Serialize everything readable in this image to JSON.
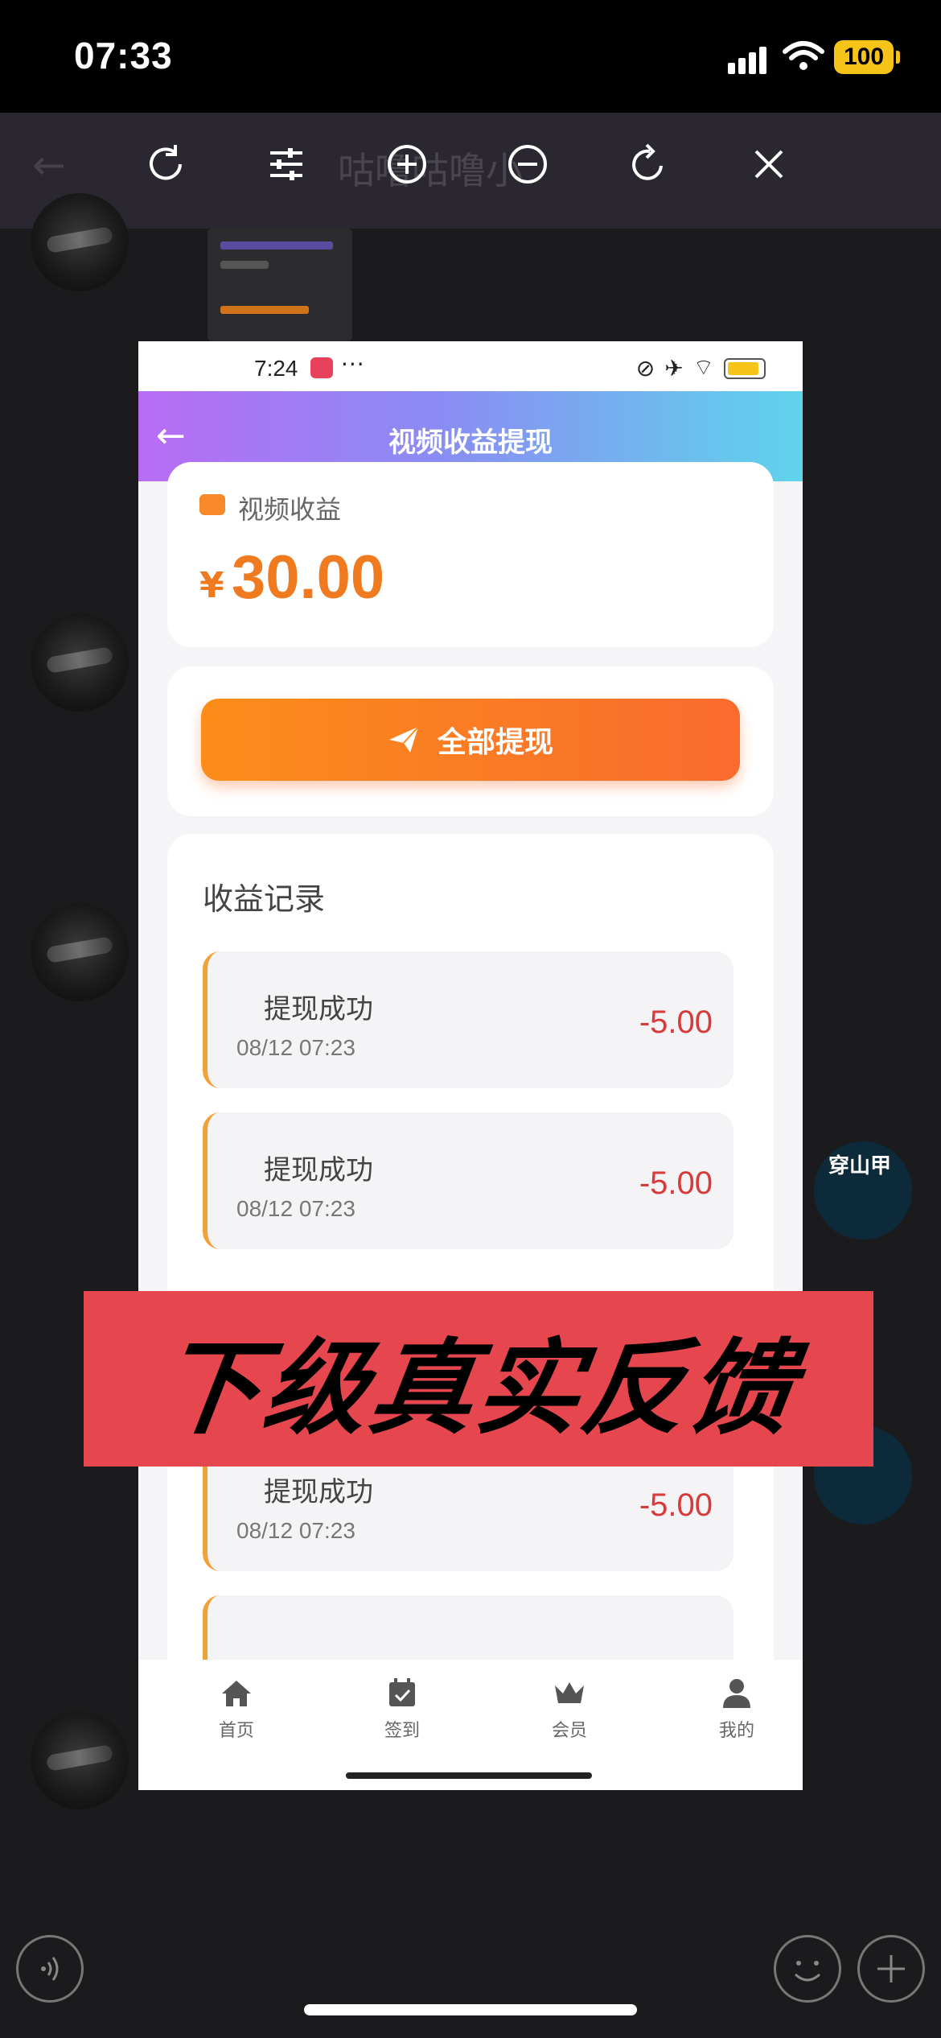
{
  "outer_status": {
    "time": "07:33",
    "battery": "100"
  },
  "viewer": {
    "bg_title": "咕噜咕噜小"
  },
  "side_labels": {
    "name": "穿山甲"
  },
  "inner_status": {
    "time": "7:24",
    "dots": "···"
  },
  "inner_header": {
    "title": "视频收益提现"
  },
  "earnings": {
    "label": "视频收益",
    "currency": "¥",
    "amount": "30.00"
  },
  "withdraw_button": {
    "label": "全部提现"
  },
  "records": {
    "title": "收益记录",
    "items": [
      {
        "title": "提现成功",
        "time": "08/12 07:23",
        "amount": "-5.00"
      },
      {
        "title": "提现成功",
        "time": "08/12 07:23",
        "amount": "-5.00"
      },
      {
        "title": "提现成功",
        "time": "08/12 07:23",
        "amount": "-5.00"
      }
    ]
  },
  "tabs": [
    {
      "label": "首页",
      "icon": "home-icon"
    },
    {
      "label": "签到",
      "icon": "calendar-check-icon"
    },
    {
      "label": "会员",
      "icon": "crown-icon"
    },
    {
      "label": "我的",
      "icon": "user-icon"
    }
  ],
  "banner": {
    "text": "下级真实反馈"
  },
  "colors": {
    "accent_orange": "#f07a20",
    "banner_red": "#e6474f",
    "amount_red": "#d83a3a"
  }
}
